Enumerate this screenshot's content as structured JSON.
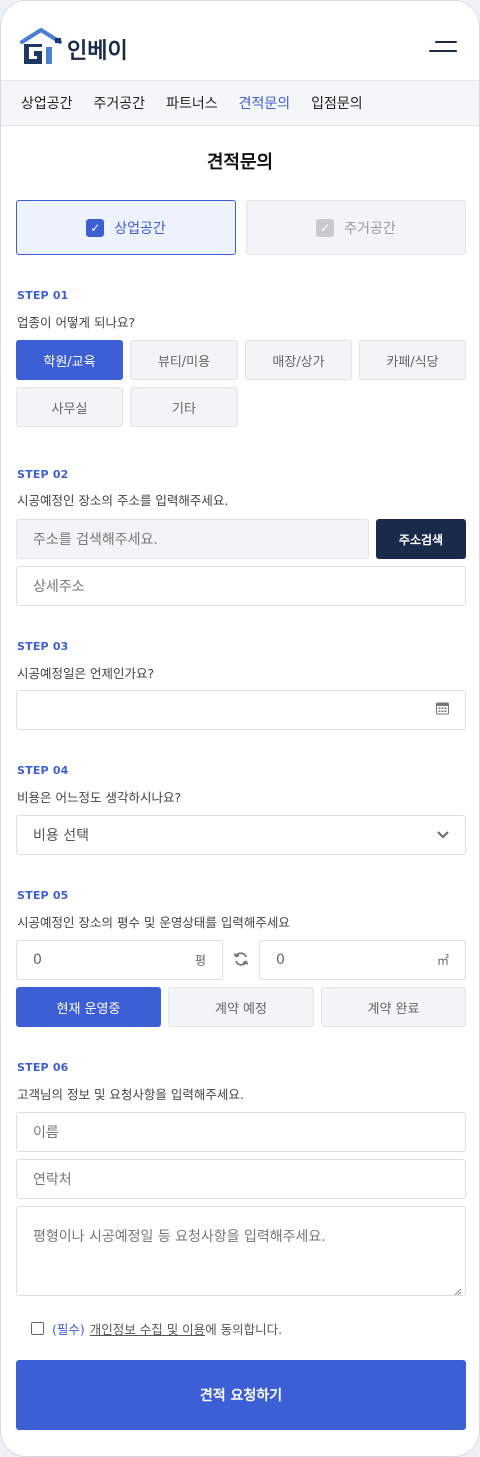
{
  "brand": {
    "name": "인베이"
  },
  "nav": {
    "items": [
      "상업공간",
      "주거공간",
      "파트너스",
      "견적문의",
      "입점문의"
    ],
    "active_index": 3
  },
  "page": {
    "title": "견적문의"
  },
  "space_type": {
    "options": [
      "상업공간",
      "주거공간"
    ],
    "selected_index": 0
  },
  "step1": {
    "label": "STEP 01",
    "question": "업종이 어떻게 되나요?",
    "options": [
      "학원/교육",
      "뷰티/미용",
      "매장/상가",
      "카페/식당",
      "사무실",
      "기타"
    ],
    "selected_index": 0
  },
  "step2": {
    "label": "STEP 02",
    "question": "시공예정인 장소의 주소를 입력해주세요.",
    "address_placeholder": "주소를 검색해주세요.",
    "search_button": "주소검색",
    "detail_placeholder": "상세주소"
  },
  "step3": {
    "label": "STEP 03",
    "question": "시공예정일은 언제인가요?",
    "date_value": ""
  },
  "step4": {
    "label": "STEP 04",
    "question": "비용은 어느정도 생각하시나요?",
    "selected": "비용 선택"
  },
  "step5": {
    "label": "STEP 05",
    "question": "시공예정인 장소의 평수 및 운영상태를 입력해주세요",
    "pyeong_value": "0",
    "pyeong_unit": "평",
    "sqm_value": "0",
    "sqm_unit": "㎡",
    "status_options": [
      "현재 운영중",
      "계약 예정",
      "계약 완료"
    ],
    "status_selected_index": 0
  },
  "step6": {
    "label": "STEP 06",
    "question": "고객님의 정보 및 요청사항을 입력해주세요.",
    "name_placeholder": "이름",
    "phone_placeholder": "연락처",
    "request_placeholder": "평형이나 시공예정일 등 요청사항을 입력해주세요."
  },
  "agreement": {
    "required": "(필수)",
    "link_text": "개인정보 수집 및 이용",
    "suffix": "에 동의합니다.",
    "checked": false
  },
  "submit": {
    "label": "견적 요청하기"
  },
  "colors": {
    "accent": "#3d5fd6",
    "dark": "#1a2a4a",
    "chip_bg": "#f3f4f6"
  }
}
